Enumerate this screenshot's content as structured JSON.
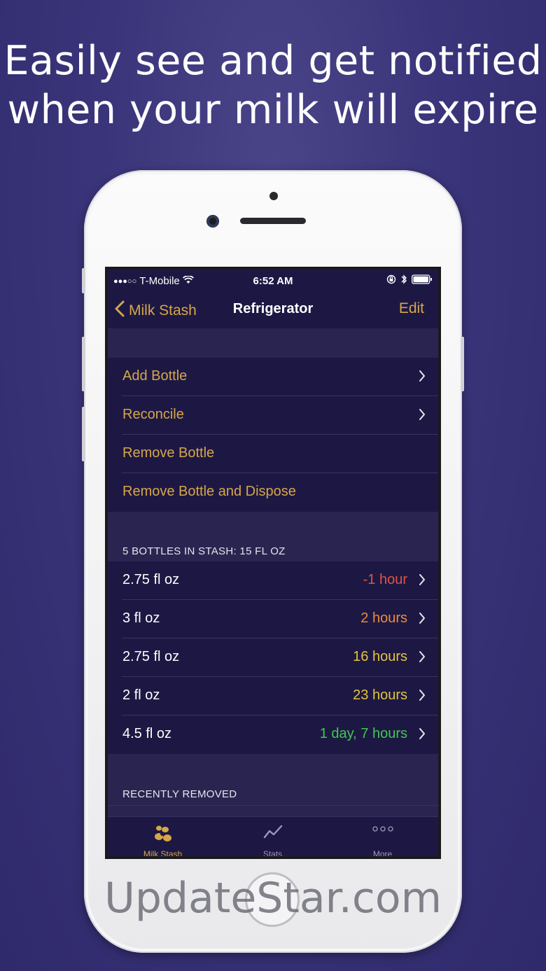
{
  "promo": {
    "line1": "Easily see and get notified",
    "line2": "when your milk will expire",
    "watermark": "UpdateStar.com"
  },
  "status_bar": {
    "signal": "●●●○○",
    "carrier": "T-Mobile",
    "time": "6:52 AM"
  },
  "nav": {
    "back_label": "Milk Stash",
    "title": "Refrigerator",
    "edit_label": "Edit"
  },
  "actions": [
    {
      "label": "Add Bottle",
      "chevron": true
    },
    {
      "label": "Reconcile",
      "chevron": true
    },
    {
      "label": "Remove Bottle",
      "chevron": false
    },
    {
      "label": "Remove Bottle and Dispose",
      "chevron": false
    }
  ],
  "stash": {
    "header": "5 BOTTLES IN STASH: 15 FL OZ",
    "bottles": [
      {
        "amount": "2.75 fl oz",
        "expires": "-1 hour",
        "color": "#e0534a"
      },
      {
        "amount": "3 fl oz",
        "expires": "2 hours",
        "color": "#ee8a3f"
      },
      {
        "amount": "2.75 fl oz",
        "expires": "16 hours",
        "color": "#e3c43b"
      },
      {
        "amount": "2 fl oz",
        "expires": "23 hours",
        "color": "#e3c43b"
      },
      {
        "amount": "4.5 fl oz",
        "expires": "1 day, 7 hours",
        "color": "#3fc94e"
      }
    ]
  },
  "recent": {
    "header": "RECENTLY REMOVED"
  },
  "tabs": [
    {
      "label": "Milk Stash",
      "icon": "milk-stash-icon",
      "active": true
    },
    {
      "label": "Stats",
      "icon": "stats-icon",
      "active": false
    },
    {
      "label": "More",
      "icon": "more-icon",
      "active": false
    }
  ],
  "colors": {
    "accent": "#d6a64a",
    "background": "#3a347a",
    "row_bg": "#1d1843",
    "inactive_tab": "#9c98b8"
  }
}
